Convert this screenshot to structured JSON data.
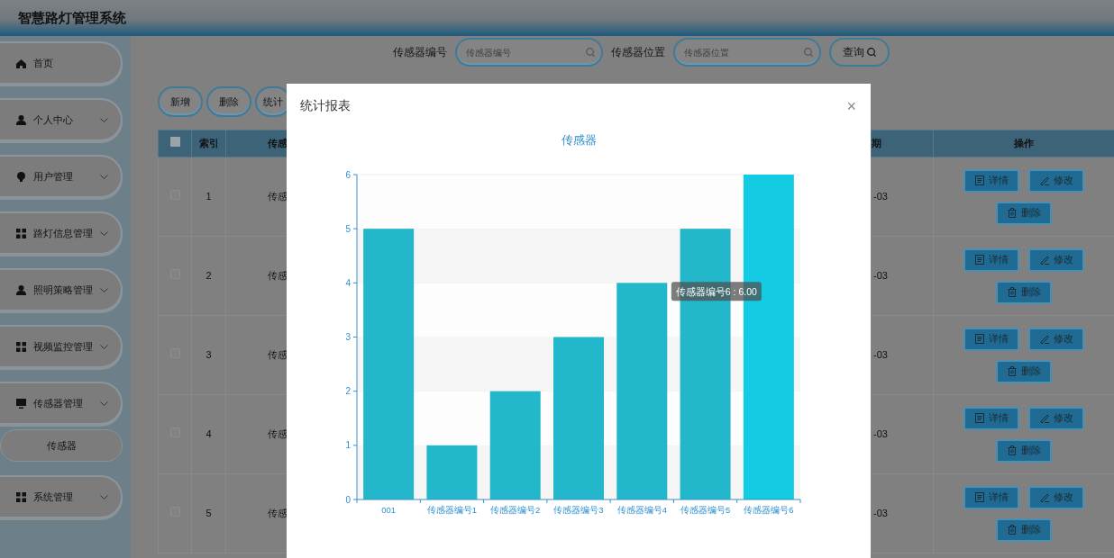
{
  "header": {
    "title": "智慧路灯管理系统"
  },
  "sidebar": {
    "items": [
      {
        "label": "首页",
        "kind": "home",
        "collapsible": false
      },
      {
        "label": "个人中心",
        "kind": "person",
        "collapsible": true
      },
      {
        "label": "用户管理",
        "kind": "bulb",
        "collapsible": true
      },
      {
        "label": "路灯信息管理",
        "kind": "grid",
        "collapsible": true
      },
      {
        "label": "照明策略管理",
        "kind": "person",
        "collapsible": true
      },
      {
        "label": "视频监控管理",
        "kind": "grid",
        "collapsible": true
      },
      {
        "label": "传感器管理",
        "kind": "monitor",
        "collapsible": true,
        "children": [
          {
            "label": "传感器"
          }
        ]
      },
      {
        "label": "系统管理",
        "kind": "grid",
        "collapsible": true
      }
    ]
  },
  "search": {
    "fields": [
      {
        "label": "传感器编号",
        "placeholder": "传感器编号"
      },
      {
        "label": "传感器位置",
        "placeholder": "传感器位置"
      }
    ],
    "button": "查询"
  },
  "toolbar": [
    "新增",
    "删除",
    "统计"
  ],
  "table": {
    "columns": [
      {
        "kind": "checkbox",
        "checked": false
      },
      {
        "kind": "index",
        "label": "索引"
      },
      {
        "kind": "name",
        "label": "传感"
      },
      {
        "kind": "date",
        "label": "期"
      },
      {
        "kind": "actions",
        "label": "操作"
      }
    ],
    "rows": [
      {
        "selected": false,
        "index": "1",
        "column_3": "传感",
        "date": "-03",
        "actions": [
          {
            "kind": "detail",
            "label": "详情"
          },
          {
            "kind": "edit",
            "label": "修改"
          },
          {
            "kind": "delete",
            "label": "删除"
          }
        ]
      },
      {
        "selected": false,
        "index": "2",
        "column_3": "传感",
        "date": "-03",
        "actions": [
          {
            "kind": "detail",
            "label": "详情"
          },
          {
            "kind": "edit",
            "label": "修改"
          },
          {
            "kind": "delete",
            "label": "删除"
          }
        ]
      },
      {
        "selected": false,
        "index": "3",
        "column_3": "传感",
        "date": "-03",
        "actions": [
          {
            "kind": "detail",
            "label": "详情"
          },
          {
            "kind": "edit",
            "label": "修改"
          },
          {
            "kind": "delete",
            "label": "删除"
          }
        ]
      },
      {
        "selected": false,
        "index": "4",
        "column_3": "传感",
        "date": "-03",
        "actions": [
          {
            "kind": "detail",
            "label": "详情"
          },
          {
            "kind": "edit",
            "label": "修改"
          },
          {
            "kind": "delete",
            "label": "删除"
          }
        ]
      },
      {
        "selected": false,
        "index": "5",
        "column_3": "传感",
        "date": "-03",
        "actions": [
          {
            "kind": "detail",
            "label": "详情"
          },
          {
            "kind": "edit",
            "label": "修改"
          },
          {
            "kind": "delete",
            "label": "删除"
          }
        ]
      }
    ]
  },
  "modal": {
    "title": "统计报表",
    "close": "×",
    "bar_states": [
      {
        "hovered": false
      },
      {
        "hovered": false
      },
      {
        "hovered": false
      },
      {
        "hovered": false
      },
      {
        "hovered": false
      },
      {
        "hovered": false
      },
      {
        "hovered": true
      }
    ],
    "chart_data": {
      "type": "bar",
      "title": "传感器",
      "categories": [
        "001",
        "传感器编号1",
        "传感器编号2",
        "传感器编号3",
        "传感器编号4",
        "传感器编号5",
        "传感器编号6"
      ],
      "series": [
        {
          "color": "#23b7cb",
          "values": [
            5,
            1,
            2,
            3,
            4,
            5,
            6
          ]
        }
      ],
      "ylim": [
        0,
        6
      ],
      "yticks": [
        0,
        1,
        2,
        3,
        4,
        5,
        6
      ],
      "annotations": [
        {
          "text": "传感器编号6 : 6.00"
        }
      ]
    }
  }
}
